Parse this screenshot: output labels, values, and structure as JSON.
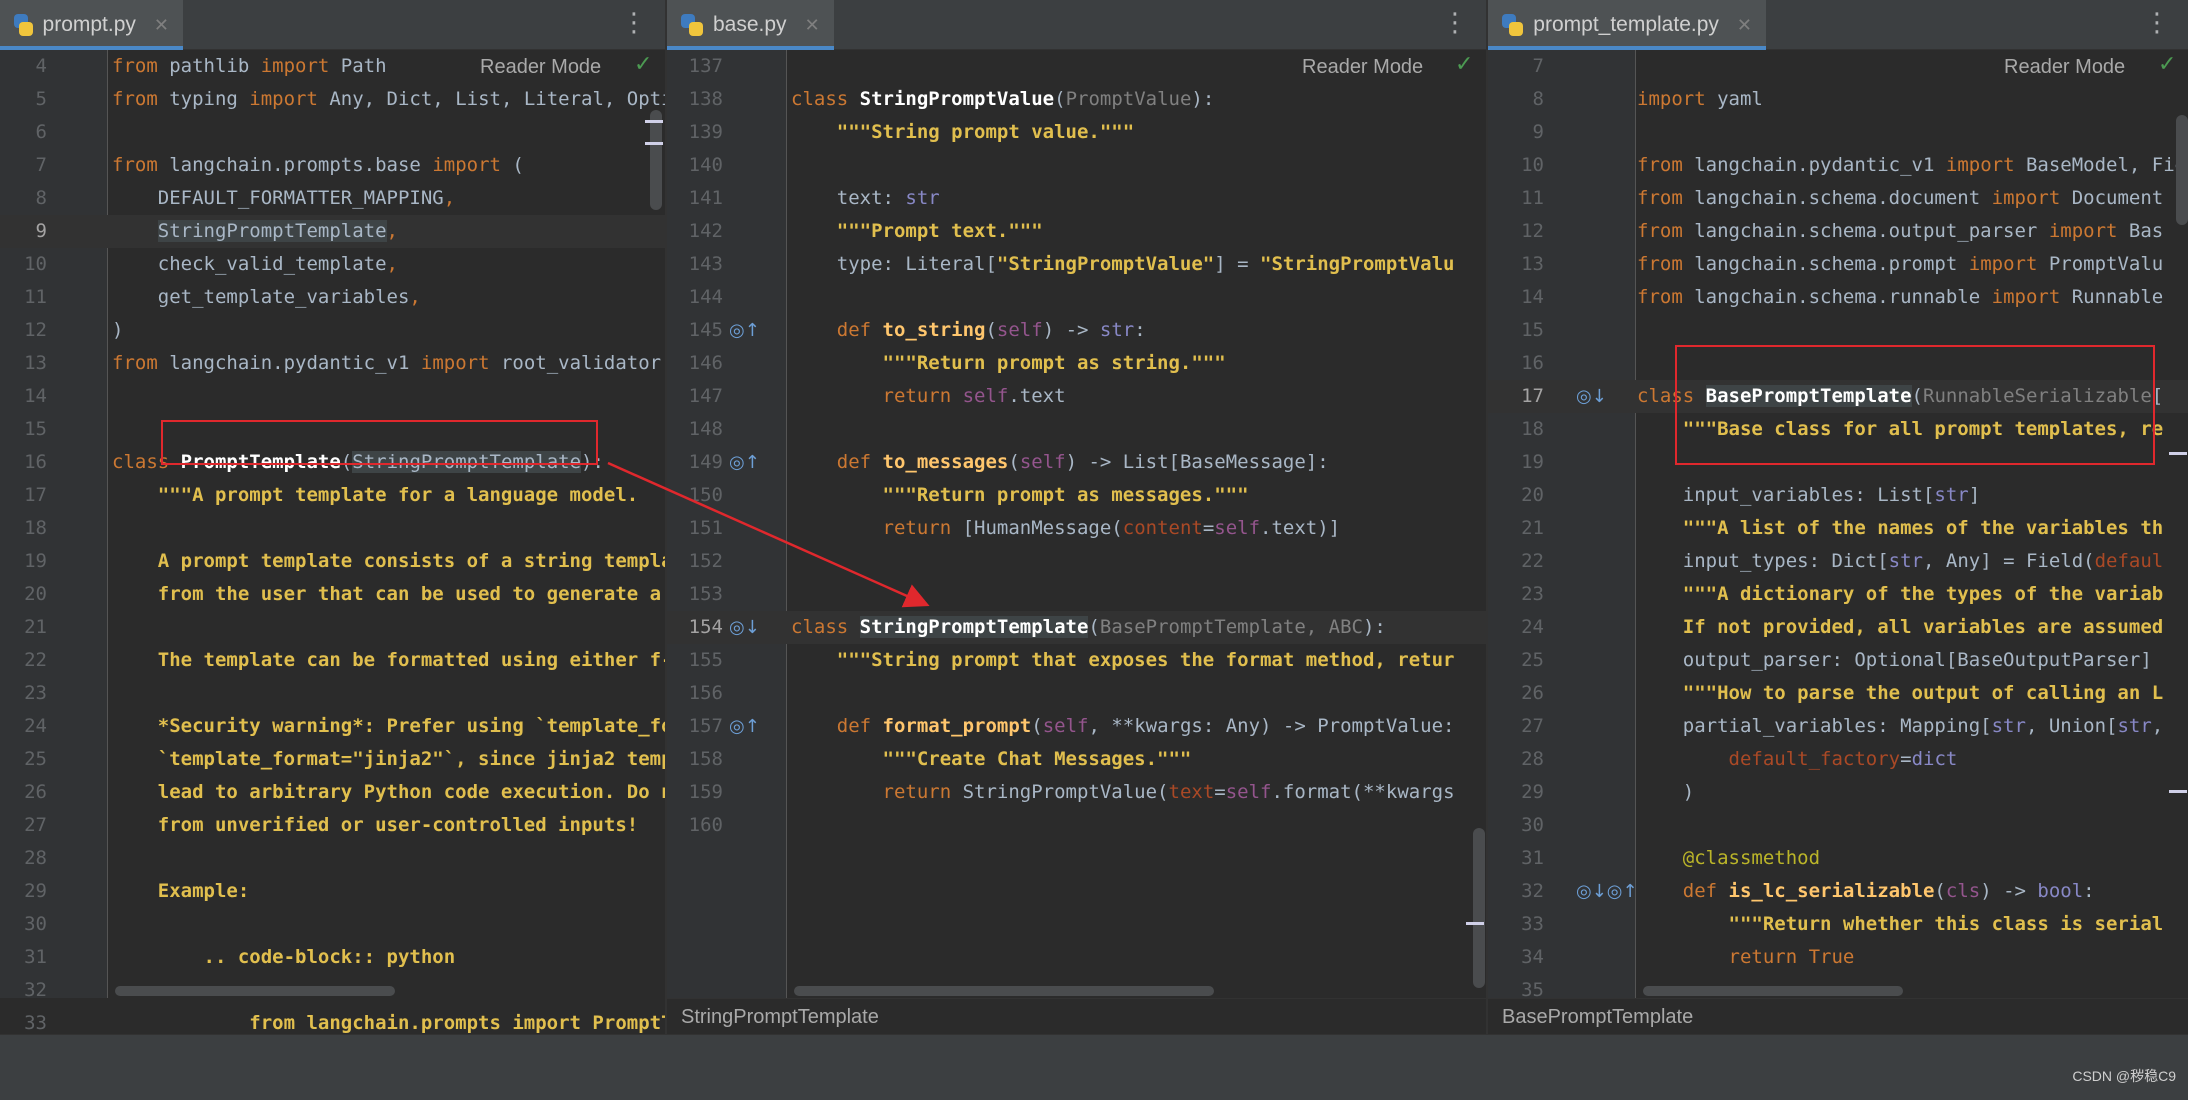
{
  "panes": [
    {
      "tab": "prompt.py",
      "reader_mode": "Reader Mode",
      "breadcrumb": "",
      "lines": [
        {
          "n": "4",
          "segs": [
            [
              "kw",
              "from "
            ],
            [
              "",
              "pathlib "
            ],
            [
              "kw",
              "import "
            ],
            [
              "",
              "Path"
            ]
          ]
        },
        {
          "n": "5",
          "segs": [
            [
              "kw",
              "from "
            ],
            [
              "",
              "typing "
            ],
            [
              "kw",
              "import "
            ],
            [
              "",
              "Any, Dict, List, Literal, Optio"
            ]
          ]
        },
        {
          "n": "6",
          "segs": []
        },
        {
          "n": "7",
          "segs": [
            [
              "kw",
              "from "
            ],
            [
              "",
              "langchain.prompts.base "
            ],
            [
              "kw",
              "import "
            ],
            [
              "",
              "("
            ]
          ]
        },
        {
          "n": "8",
          "segs": [
            [
              "",
              "    DEFAULT_FORMATTER_MAPPING"
            ],
            [
              "kw",
              ","
            ]
          ]
        },
        {
          "n": "9",
          "cur": true,
          "segs": [
            [
              "",
              "    "
            ],
            [
              "hl",
              "StringPromptTemplate"
            ],
            [
              "kw",
              ","
            ]
          ]
        },
        {
          "n": "10",
          "segs": [
            [
              "",
              "    check_valid_template"
            ],
            [
              "kw",
              ","
            ]
          ]
        },
        {
          "n": "11",
          "segs": [
            [
              "",
              "    get_template_variables"
            ],
            [
              "kw",
              ","
            ]
          ]
        },
        {
          "n": "12",
          "segs": [
            [
              "",
              ")"
            ]
          ]
        },
        {
          "n": "13",
          "segs": [
            [
              "kw",
              "from "
            ],
            [
              "",
              "langchain.pydantic_v1 "
            ],
            [
              "kw",
              "import "
            ],
            [
              "",
              "root_validator"
            ]
          ]
        },
        {
          "n": "14",
          "segs": []
        },
        {
          "n": "15",
          "segs": []
        },
        {
          "n": "16",
          "segs": [
            [
              "kw",
              "class "
            ],
            [
              "cls",
              "PromptTemplate"
            ],
            [
              "",
              "("
            ],
            [
              "hl",
              "StringPromptTemplate"
            ],
            [
              "",
              "):"
            ]
          ]
        },
        {
          "n": "17",
          "segs": [
            [
              "str",
              "    \"\"\"A prompt template for a language model."
            ]
          ]
        },
        {
          "n": "18",
          "segs": []
        },
        {
          "n": "19",
          "segs": [
            [
              "str",
              "    A prompt template consists of a string templat"
            ]
          ]
        },
        {
          "n": "20",
          "segs": [
            [
              "str",
              "    from the user that can be used to generate a p"
            ]
          ]
        },
        {
          "n": "21",
          "segs": []
        },
        {
          "n": "22",
          "segs": [
            [
              "str",
              "    The template can be formatted using either f-st"
            ]
          ]
        },
        {
          "n": "23",
          "segs": []
        },
        {
          "n": "24",
          "segs": [
            [
              "str",
              "    *Security warning*: Prefer using `template_form"
            ]
          ]
        },
        {
          "n": "25",
          "segs": [
            [
              "str",
              "    `template_format=\"jinja2\"`, since jinja2 templ"
            ]
          ]
        },
        {
          "n": "26",
          "segs": [
            [
              "str",
              "    lead to arbitrary Python code execution. Do not"
            ]
          ]
        },
        {
          "n": "27",
          "segs": [
            [
              "str",
              "    from unverified or user-controlled inputs!"
            ]
          ]
        },
        {
          "n": "28",
          "segs": []
        },
        {
          "n": "29",
          "segs": [
            [
              "str",
              "    Example:"
            ]
          ]
        },
        {
          "n": "30",
          "segs": []
        },
        {
          "n": "31",
          "segs": [
            [
              "str",
              "        .. code-block:: python"
            ]
          ]
        },
        {
          "n": "32",
          "segs": []
        },
        {
          "n": "33",
          "segs": [
            [
              "str",
              "            from langchain.prompts import PromptTem"
            ]
          ]
        }
      ]
    },
    {
      "tab": "base.py",
      "reader_mode": "Reader Mode",
      "breadcrumb": "StringPromptTemplate",
      "lines": [
        {
          "n": "137",
          "segs": []
        },
        {
          "n": "138",
          "segs": [
            [
              "kw",
              "class "
            ],
            [
              "cls",
              "StringPromptValue"
            ],
            [
              "",
              "("
            ],
            [
              "dim",
              "PromptValue"
            ],
            [
              "",
              "):"
            ]
          ]
        },
        {
          "n": "139",
          "segs": [
            [
              "str",
              "    \"\"\"String prompt value.\"\"\""
            ]
          ]
        },
        {
          "n": "140",
          "segs": []
        },
        {
          "n": "141",
          "segs": [
            [
              "",
              "    text: "
            ],
            [
              "bt",
              "str"
            ]
          ]
        },
        {
          "n": "142",
          "segs": [
            [
              "str",
              "    \"\"\"Prompt text.\"\"\""
            ]
          ]
        },
        {
          "n": "143",
          "segs": [
            [
              "",
              "    type: Literal["
            ],
            [
              "str",
              "\"StringPromptValue\""
            ],
            [
              "",
              "] = "
            ],
            [
              "str",
              "\"StringPromptValu"
            ]
          ]
        },
        {
          "n": "144",
          "segs": []
        },
        {
          "n": "145",
          "icon": "◎↑",
          "segs": [
            [
              "kw",
              "    def "
            ],
            [
              "fn",
              "to_string"
            ],
            [
              "",
              "("
            ],
            [
              "sf",
              "self"
            ],
            [
              "",
              ") -> "
            ],
            [
              "bt",
              "str"
            ],
            [
              "",
              ":"
            ]
          ]
        },
        {
          "n": "146",
          "segs": [
            [
              "str",
              "        \"\"\"Return prompt as string.\"\"\""
            ]
          ]
        },
        {
          "n": "147",
          "segs": [
            [
              "kw",
              "        return "
            ],
            [
              "sf",
              "self"
            ],
            [
              "",
              ".text"
            ]
          ]
        },
        {
          "n": "148",
          "segs": []
        },
        {
          "n": "149",
          "icon": "◎↑",
          "segs": [
            [
              "kw",
              "    def "
            ],
            [
              "fn",
              "to_messages"
            ],
            [
              "",
              "("
            ],
            [
              "sf",
              "self"
            ],
            [
              "",
              ") -> List[BaseMessage]:"
            ]
          ]
        },
        {
          "n": "150",
          "segs": [
            [
              "str",
              "        \"\"\"Return prompt as messages.\"\"\""
            ]
          ]
        },
        {
          "n": "151",
          "segs": [
            [
              "kw",
              "        return "
            ],
            [
              "",
              "[HumanMessage("
            ],
            [
              "kp",
              "content"
            ],
            [
              "",
              "="
            ],
            [
              "sf",
              "self"
            ],
            [
              "",
              ".text)]"
            ]
          ]
        },
        {
          "n": "152",
          "segs": []
        },
        {
          "n": "153",
          "segs": []
        },
        {
          "n": "154",
          "cur": true,
          "icon": "◎↓",
          "segs": [
            [
              "kw",
              "class "
            ],
            [
              "cls hl",
              "StringPromptTemplate"
            ],
            [
              "",
              "("
            ],
            [
              "dim",
              "BasePromptTemplate, ABC"
            ],
            [
              "",
              "):"
            ]
          ]
        },
        {
          "n": "155",
          "segs": [
            [
              "str",
              "    \"\"\"String prompt that exposes the format method, retur"
            ]
          ]
        },
        {
          "n": "156",
          "segs": []
        },
        {
          "n": "157",
          "icon": "◎↑",
          "segs": [
            [
              "kw",
              "    def "
            ],
            [
              "fn",
              "format_prompt"
            ],
            [
              "",
              "("
            ],
            [
              "sf",
              "self"
            ],
            [
              "",
              ", **kwargs: Any) -> PromptValue:"
            ]
          ]
        },
        {
          "n": "158",
          "segs": [
            [
              "str",
              "        \"\"\"Create Chat Messages.\"\"\""
            ]
          ]
        },
        {
          "n": "159",
          "segs": [
            [
              "kw",
              "        return "
            ],
            [
              "",
              "StringPromptValue("
            ],
            [
              "kp",
              "text"
            ],
            [
              "",
              "="
            ],
            [
              "sf",
              "self"
            ],
            [
              "",
              ".format(**kwargs"
            ]
          ]
        },
        {
          "n": "160",
          "segs": []
        }
      ]
    },
    {
      "tab": "prompt_template.py",
      "reader_mode": "Reader Mode",
      "breadcrumb": "BasePromptTemplate",
      "lines": [
        {
          "n": "7",
          "segs": []
        },
        {
          "n": "8",
          "segs": [
            [
              "kw",
              "import "
            ],
            [
              "",
              "yaml"
            ]
          ]
        },
        {
          "n": "9",
          "segs": []
        },
        {
          "n": "10",
          "segs": [
            [
              "kw",
              "from "
            ],
            [
              "",
              "langchain.pydantic_v1 "
            ],
            [
              "kw",
              "import "
            ],
            [
              "",
              "BaseModel, Field"
            ]
          ]
        },
        {
          "n": "11",
          "segs": [
            [
              "kw",
              "from "
            ],
            [
              "",
              "langchain.schema.document "
            ],
            [
              "kw",
              "import "
            ],
            [
              "",
              "Document"
            ]
          ]
        },
        {
          "n": "12",
          "segs": [
            [
              "kw",
              "from "
            ],
            [
              "",
              "langchain.schema.output_parser "
            ],
            [
              "kw",
              "import "
            ],
            [
              "",
              "Bas"
            ]
          ]
        },
        {
          "n": "13",
          "segs": [
            [
              "kw",
              "from "
            ],
            [
              "",
              "langchain.schema.prompt "
            ],
            [
              "kw",
              "import "
            ],
            [
              "",
              "PromptValu"
            ]
          ]
        },
        {
          "n": "14",
          "segs": [
            [
              "kw",
              "from "
            ],
            [
              "",
              "langchain.schema.runnable "
            ],
            [
              "kw",
              "import "
            ],
            [
              "",
              "Runnable"
            ]
          ]
        },
        {
          "n": "15",
          "segs": []
        },
        {
          "n": "16",
          "segs": []
        },
        {
          "n": "17",
          "cur": true,
          "icon": "◎↓",
          "segs": [
            [
              "kw",
              "class "
            ],
            [
              "cls hl",
              "BasePromptTemplate"
            ],
            [
              "",
              "("
            ],
            [
              "dim",
              "RunnableSerializable"
            ],
            [
              "",
              "["
            ]
          ]
        },
        {
          "n": "18",
          "segs": [
            [
              "str",
              "    \"\"\"Base class for all prompt templates, re"
            ]
          ]
        },
        {
          "n": "19",
          "segs": []
        },
        {
          "n": "20",
          "segs": [
            [
              "",
              "    input_variables: List["
            ],
            [
              "bt",
              "str"
            ],
            [
              "",
              "]"
            ]
          ]
        },
        {
          "n": "21",
          "segs": [
            [
              "str",
              "    \"\"\"A list of the names of the variables th"
            ]
          ]
        },
        {
          "n": "22",
          "segs": [
            [
              "",
              "    input_types: Dict["
            ],
            [
              "bt",
              "str"
            ],
            [
              "",
              ", Any] = Field("
            ],
            [
              "kp",
              "defaul"
            ]
          ]
        },
        {
          "n": "23",
          "segs": [
            [
              "str",
              "    \"\"\"A dictionary of the types of the variab"
            ]
          ]
        },
        {
          "n": "24",
          "segs": [
            [
              "str",
              "    If not provided, all variables are assumed"
            ]
          ]
        },
        {
          "n": "25",
          "segs": [
            [
              "",
              "    output_parser: Optional[BaseOutputParser]"
            ]
          ]
        },
        {
          "n": "26",
          "segs": [
            [
              "str",
              "    \"\"\"How to parse the output of calling an L"
            ]
          ]
        },
        {
          "n": "27",
          "segs": [
            [
              "",
              "    partial_variables: Mapping["
            ],
            [
              "bt",
              "str"
            ],
            [
              "",
              ", Union["
            ],
            [
              "bt",
              "str"
            ],
            [
              "",
              ","
            ]
          ]
        },
        {
          "n": "28",
          "segs": [
            [
              "kp",
              "        default_factory"
            ],
            [
              "",
              "="
            ],
            [
              "bt",
              "dict"
            ]
          ]
        },
        {
          "n": "29",
          "segs": [
            [
              "",
              "    )"
            ]
          ]
        },
        {
          "n": "30",
          "segs": []
        },
        {
          "n": "31",
          "segs": [
            [
              "dec",
              "    @classmethod"
            ]
          ]
        },
        {
          "n": "32",
          "icon": "◎↓◎↑",
          "segs": [
            [
              "kw",
              "    def "
            ],
            [
              "fn",
              "is_lc_serializable"
            ],
            [
              "",
              "("
            ],
            [
              "sf",
              "cls"
            ],
            [
              "",
              ") -> "
            ],
            [
              "bt",
              "bool"
            ],
            [
              "",
              ":"
            ]
          ]
        },
        {
          "n": "33",
          "segs": [
            [
              "str",
              "        \"\"\"Return whether this class is serial"
            ]
          ]
        },
        {
          "n": "34",
          "segs": [
            [
              "kw",
              "        return "
            ],
            [
              "kw",
              "True"
            ]
          ]
        },
        {
          "n": "35",
          "segs": []
        }
      ]
    }
  ],
  "watermark": "CSDN @秽稳C9",
  "colors": {
    "keyword": "#cc7832",
    "docstring": "#e1bf4e",
    "annotation_red": "#e0282d",
    "tab_underline": "#4a88c7"
  }
}
